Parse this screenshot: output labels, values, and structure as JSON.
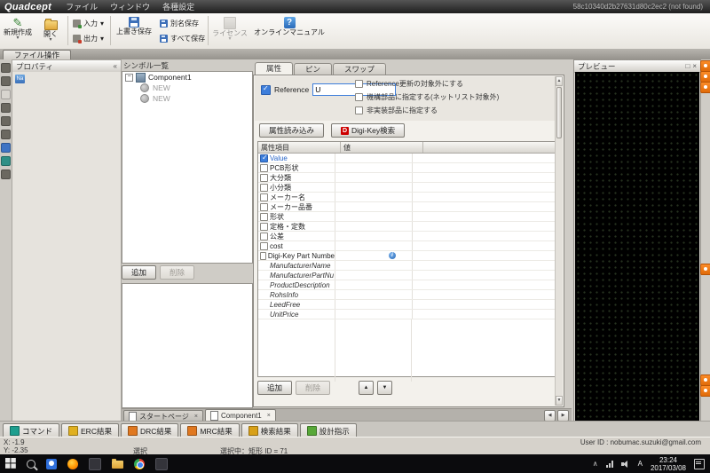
{
  "titlebar": {
    "app_name": "Quadcept",
    "menus": [
      "ファイル",
      "ウィンドウ",
      "各種設定"
    ],
    "session_id": "58c10340d2b27631d80c2ec2 (not found)"
  },
  "ribbon": {
    "tab_label": "ファイル操作",
    "new_label": "新規作成",
    "open_label": "開く",
    "input_label": "入力",
    "output_label": "出力",
    "overwrite_save_label": "上書き保存",
    "save_as_label": "別名保存",
    "save_all_label": "すべて保存",
    "license_label": "ライセンス",
    "manual_label": "オンラインマニュアル"
  },
  "property_panel": {
    "title": "プロパティ"
  },
  "symbol_panel": {
    "title": "シンボル一覧",
    "tree": [
      {
        "label": "Component1"
      },
      {
        "label": "NEW"
      },
      {
        "label": "NEW"
      }
    ],
    "add_label": "追加",
    "delete_label": "削除"
  },
  "attribute_panel": {
    "tabs": [
      {
        "label": "属性"
      },
      {
        "label": "ピン"
      },
      {
        "label": "スワップ"
      }
    ],
    "reference_label": "Reference",
    "reference_value": "U",
    "options": [
      {
        "label": "Reference更新の対象外にする",
        "checked": false
      },
      {
        "label": "機構部品に指定する(ネットリスト対象外)",
        "checked": false
      },
      {
        "label": "非実装部品に指定する",
        "checked": false
      }
    ],
    "load_button_label": "属性読み込み",
    "digikey_button_label": "Digi-Key検索",
    "table_headers": {
      "name": "属性項目",
      "value": "値"
    },
    "rows": [
      {
        "label": "Value",
        "checked": true,
        "highlighted": true
      },
      {
        "label": "PCB形状",
        "checked": false
      },
      {
        "label": "大分類",
        "checked": false
      },
      {
        "label": "小分類",
        "checked": false
      },
      {
        "label": "メーカー名",
        "checked": false
      },
      {
        "label": "メーカー品番",
        "checked": false
      },
      {
        "label": "形状",
        "checked": false
      },
      {
        "label": "定格・定数",
        "checked": false
      },
      {
        "label": "公差",
        "checked": false
      },
      {
        "label": "cost",
        "checked": false
      },
      {
        "label": "Digi-Key Part Numbe",
        "checked": false,
        "info_icon": true
      },
      {
        "label": "ManufacturerName",
        "italic": true
      },
      {
        "label": "ManufacturerPartNu",
        "italic": true
      },
      {
        "label": "ProductDescription",
        "italic": true
      },
      {
        "label": "RohsInfo",
        "italic": true
      },
      {
        "label": "LeedFree",
        "italic": true
      },
      {
        "label": "UnitPrice",
        "italic": true
      }
    ],
    "add_label": "追加",
    "delete_label": "削除"
  },
  "document_tabs": [
    {
      "label": "スタートページ",
      "active": false
    },
    {
      "label": "Component1",
      "active": true
    }
  ],
  "preview_panel": {
    "title": "プレビュー"
  },
  "output_tabs": [
    {
      "label": "コマンド",
      "icon_color": "#1e9e8e"
    },
    {
      "label": "ERC結果",
      "icon_color": "#e0b020"
    },
    {
      "label": "DRC結果",
      "icon_color": "#e07820"
    },
    {
      "label": "MRC結果",
      "icon_color": "#e07820"
    },
    {
      "label": "検索結果",
      "icon_color": "#d8a018"
    },
    {
      "label": "設計指示",
      "icon_color": "#58a838"
    }
  ],
  "statusbar": {
    "x_coord": "X: -1.9",
    "y_coord": "Y: -2.35",
    "mode": "選択",
    "selection_info": "選択中：矩形  ID = 71",
    "user_id": "User ID : nobumac.suzuki@gmail.com"
  },
  "taskbar": {
    "clock_time": "23:24",
    "clock_date": "2017/03/08"
  },
  "colors": {
    "accent_blue": "#3d7edb",
    "digikey_red": "#cc0000",
    "overlay_orange": "#f07818",
    "highlight_row_text": "#2a66c8"
  }
}
